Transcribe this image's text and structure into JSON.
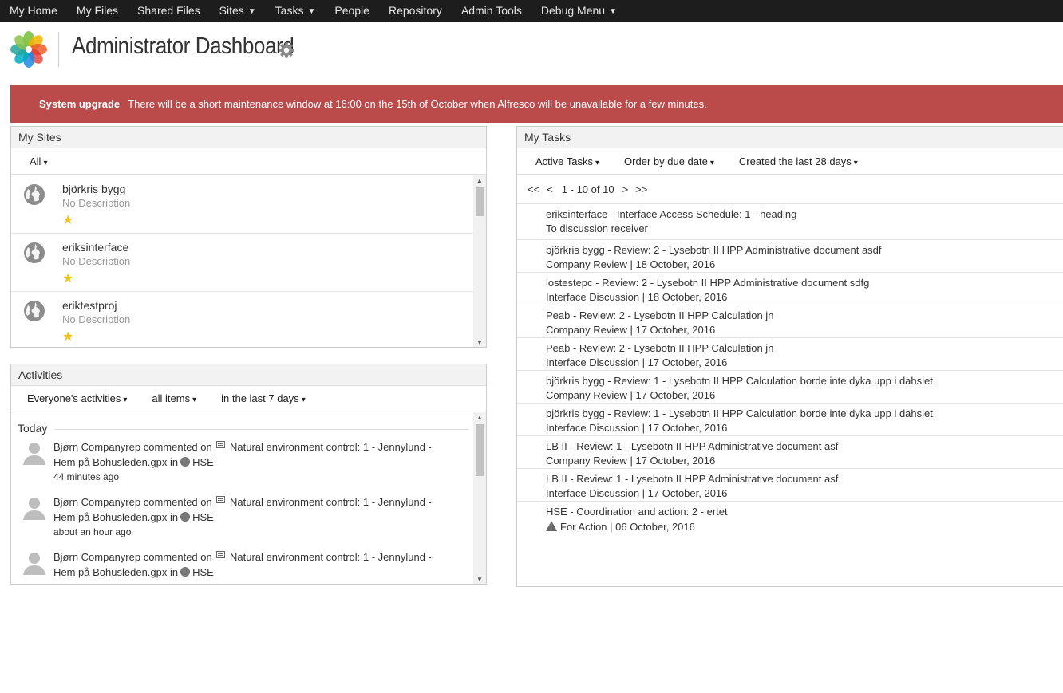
{
  "nav": {
    "items": [
      {
        "label": "My Home",
        "dropdown": false
      },
      {
        "label": "My Files",
        "dropdown": false
      },
      {
        "label": "Shared Files",
        "dropdown": false
      },
      {
        "label": "Sites",
        "dropdown": true
      },
      {
        "label": "Tasks",
        "dropdown": true
      },
      {
        "label": "People",
        "dropdown": false
      },
      {
        "label": "Repository",
        "dropdown": false
      },
      {
        "label": "Admin Tools",
        "dropdown": false
      },
      {
        "label": "Debug Menu",
        "dropdown": true
      }
    ],
    "caret": "▼"
  },
  "header": {
    "title": "Administrator Dashboard",
    "logo_icon": "alfresco-flower-logo",
    "settings_icon": "gear-icon"
  },
  "banner": {
    "title": "System upgrade",
    "message": "There will be a short maintenance window at 16:00 on the 15th of October when Alfresco will be unavailable for a few minutes.",
    "color": "#bb4b4b"
  },
  "my_sites": {
    "title": "My Sites",
    "filter": "All",
    "sites": [
      {
        "name": "björkris bygg",
        "description": "No Description",
        "favorite": true
      },
      {
        "name": "eriksinterface",
        "description": "No Description",
        "favorite": true
      },
      {
        "name": "eriktestproj",
        "description": "No Description",
        "favorite": true
      }
    ]
  },
  "activities": {
    "title": "Activities",
    "filters": [
      "Everyone's activities",
      "all items",
      "in the last 7 days"
    ],
    "group_label": "Today",
    "items": [
      {
        "user": "Bjørn Companyrep",
        "action": "commented on",
        "document": "Natural environment control: 1 - Jennylund -",
        "document_cont": "Hem på Bohusleden.gpx",
        "in_word": "in",
        "site": "HSE",
        "time": "44 minutes ago"
      },
      {
        "user": "Bjørn Companyrep",
        "action": "commented on",
        "document": "Natural environment control: 1 - Jennylund -",
        "document_cont": "Hem på Bohusleden.gpx",
        "in_word": "in",
        "site": "HSE",
        "time": "about an hour ago"
      },
      {
        "user": "Bjørn Companyrep",
        "action": "commented on",
        "document": "Natural environment control: 1 - Jennylund -",
        "document_cont": "Hem på Bohusleden.gpx",
        "in_word": "in",
        "site": "HSE",
        "time": ""
      }
    ]
  },
  "my_tasks": {
    "title": "My Tasks",
    "filters": [
      "Active Tasks",
      "Order by due date",
      "Created the last 28 days"
    ],
    "pager": {
      "first": "<<",
      "prev": "<",
      "range": "1 - 10 of 10",
      "next": ">",
      "last": ">>"
    },
    "tasks": [
      {
        "title": "eriksinterface - Interface Access Schedule: 1 - heading",
        "detail": "To discussion receiver",
        "warning": false
      },
      {
        "title": "björkris bygg - Review: 2 - Lysebotn II HPP Administrative document asdf",
        "detail": "Company Review | 18 October, 2016",
        "warning": false
      },
      {
        "title": "lostestepc - Review: 2 - Lysebotn II HPP Administrative document sdfg",
        "detail": "Interface Discussion | 18 October, 2016",
        "warning": false
      },
      {
        "title": "Peab - Review: 2 - Lysebotn II HPP Calculation jn",
        "detail": "Company Review | 17 October, 2016",
        "warning": false
      },
      {
        "title": "Peab - Review: 2 - Lysebotn II HPP Calculation jn",
        "detail": "Interface Discussion | 17 October, 2016",
        "warning": false
      },
      {
        "title": "björkris bygg - Review: 1 - Lysebotn II HPP Calculation borde inte dyka upp i dahslet",
        "detail": "Company Review | 17 October, 2016",
        "warning": false
      },
      {
        "title": "björkris bygg - Review: 1 - Lysebotn II HPP Calculation borde inte dyka upp i dahslet",
        "detail": "Interface Discussion | 17 October, 2016",
        "warning": false
      },
      {
        "title": "LB II - Review: 1 - Lysebotn II HPP Administrative document asf",
        "detail": "Company Review | 17 October, 2016",
        "warning": false
      },
      {
        "title": "LB II - Review: 1 - Lysebotn II HPP Administrative document asf",
        "detail": "Interface Discussion | 17 October, 2016",
        "warning": false
      },
      {
        "title": "HSE - Coordination and action: 2 - ertet",
        "detail": "For Action | 06 October, 2016",
        "warning": true
      }
    ]
  },
  "dropdown_caret": "▾",
  "star_glyph": "★"
}
